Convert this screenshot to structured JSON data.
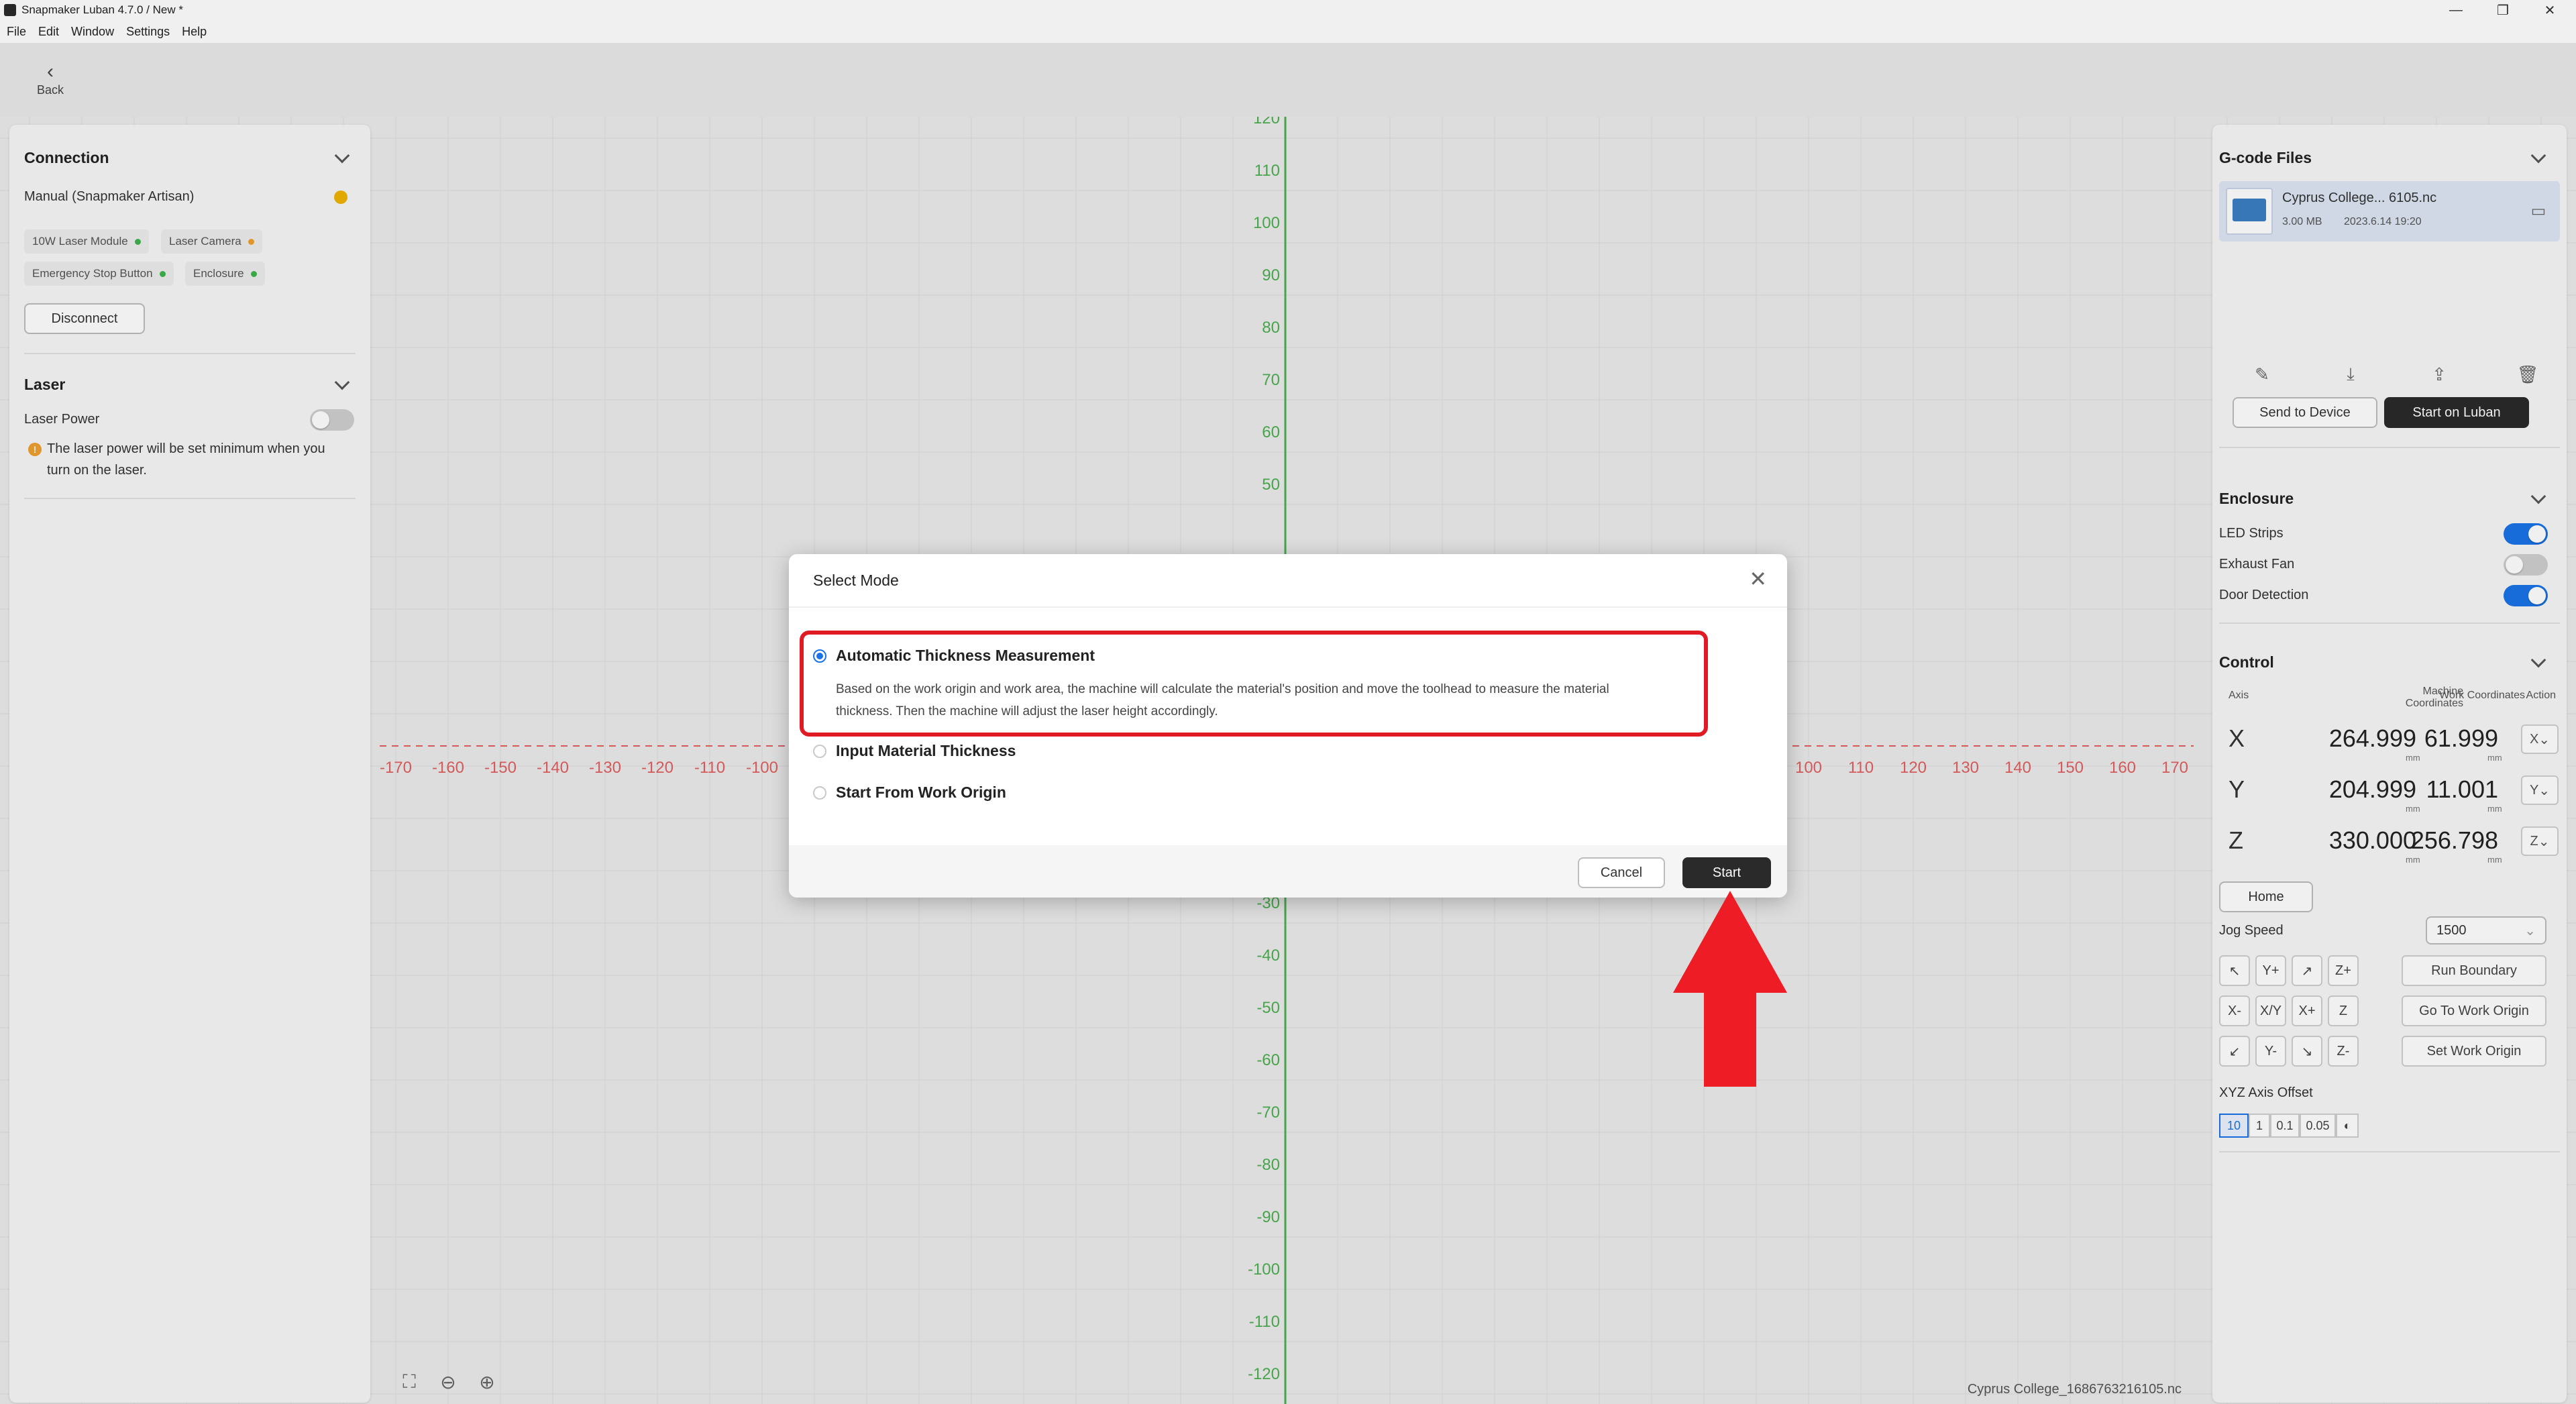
{
  "window": {
    "title": "Snapmaker Luban 4.7.0 / New *",
    "controls": [
      "—",
      "❐",
      "✕"
    ]
  },
  "menu": [
    "File",
    "Edit",
    "Window",
    "Settings",
    "Help"
  ],
  "back_label": "Back",
  "left_panel": {
    "connection": {
      "title": "Connection",
      "machine": "Manual (Snapmaker Artisan)",
      "modules": [
        {
          "label": "10W Laser Module",
          "status_color": "#3cb44b"
        },
        {
          "label": "Laser Camera",
          "status_color": "#f0a030"
        },
        {
          "label": "Emergency Stop Button",
          "status_color": "#3cb44b"
        },
        {
          "label": "Enclosure",
          "status_color": "#3cb44b"
        }
      ],
      "disconnect_label": "Disconnect"
    },
    "laser": {
      "title": "Laser",
      "power_label": "Laser Power",
      "warning_line1": "The laser power will be set minimum when you",
      "warning_line2": "turn on the laser."
    }
  },
  "right_panel": {
    "gcode": {
      "title": "G-code Files",
      "file_name": "Cyprus College... 6105.nc",
      "file_size": "3.00 MB",
      "file_date": "2023.6.14 19:20",
      "send_label": "Send to Device",
      "start_label": "Start on Luban"
    },
    "enclosure": {
      "title": "Enclosure",
      "items": [
        {
          "label": "LED Strips",
          "on": true
        },
        {
          "label": "Exhaust Fan",
          "on": false
        },
        {
          "label": "Door Detection",
          "on": true
        }
      ]
    },
    "control": {
      "title": "Control",
      "col_axis": "Axis",
      "col_machine_1": "Machine",
      "col_machine_2": "Coordinates",
      "col_work": "Work Coordinates",
      "col_action": "Action",
      "unit": "mm",
      "axes": [
        {
          "axis": "X",
          "machine": "264.999",
          "work": "61.999",
          "action": "X"
        },
        {
          "axis": "Y",
          "machine": "204.999",
          "work": "11.001",
          "action": "Y"
        },
        {
          "axis": "Z",
          "machine": "330.000",
          "work": "256.798",
          "action": "Z"
        }
      ],
      "home_label": "Home",
      "jog_speed_label": "Jog Speed",
      "jog_speed_value": "1500",
      "jog_buttons": [
        "↖",
        "Y+",
        "↗",
        "Z+",
        "X-",
        "X/Y",
        "X+",
        "Z",
        "↙",
        "Y-",
        "↘",
        "Z-"
      ],
      "run_boundary": "Run Boundary",
      "go_to_origin": "Go To Work Origin",
      "set_origin": "Set Work Origin",
      "offset_label": "XYZ Axis Offset",
      "offsets": [
        "10",
        "1",
        "0.1",
        "0.05"
      ]
    }
  },
  "canvas": {
    "y_ticks": [
      "120",
      "110",
      "100",
      "90",
      "80",
      "70",
      "60",
      "50",
      "-30",
      "-40",
      "-50",
      "-60",
      "-70",
      "-80",
      "-90",
      "-100",
      "-110",
      "-120"
    ],
    "x_ticks_left": [
      "-170",
      "-160",
      "-150",
      "-140",
      "-130",
      "-120",
      "-110",
      "-100"
    ],
    "x_ticks_right": [
      "100",
      "110",
      "120",
      "130",
      "140",
      "150",
      "160",
      "170"
    ],
    "footer_file": "Cyprus College_1686763216105.nc"
  },
  "modal": {
    "title": "Select Mode",
    "options": [
      {
        "label": "Automatic Thickness Measurement",
        "selected": true
      },
      {
        "label": "Input Material Thickness",
        "selected": false
      },
      {
        "label": "Start From Work Origin",
        "selected": false
      }
    ],
    "description_line1": "Based on the work origin and work area, the machine will calculate the material's position and move the toolhead to measure the material",
    "description_line2": "thickness. Then the machine will adjust the laser height accordingly.",
    "cancel_label": "Cancel",
    "start_label": "Start"
  },
  "colors": {
    "accent": "#1a73e8",
    "dark_button": "#2a2a2a",
    "annotation_red": "#e01b24",
    "grid_green": "#4caf50",
    "grid_red": "#e06060"
  }
}
